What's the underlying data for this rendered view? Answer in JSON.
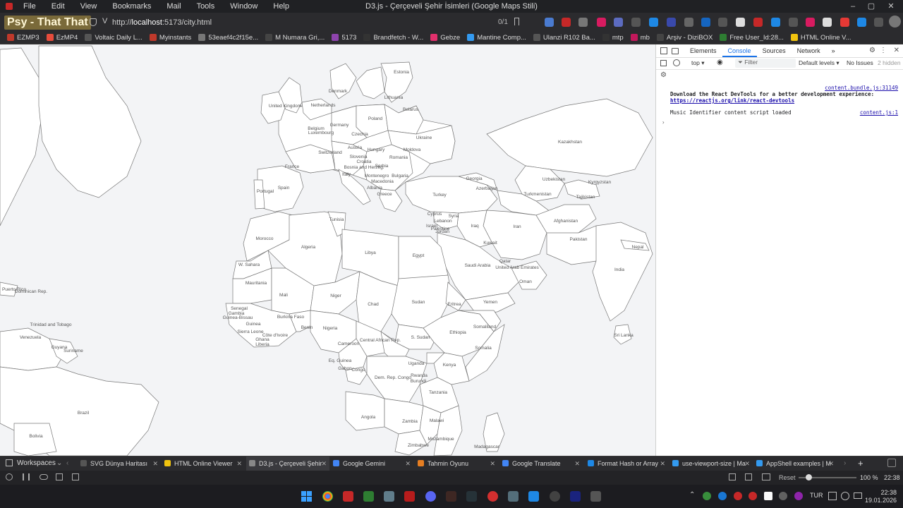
{
  "menubar": {
    "items": [
      "File",
      "Edit",
      "View",
      "Bookmarks",
      "Mail",
      "Tools",
      "Window",
      "Help"
    ]
  },
  "window": {
    "title": "D3.js - Çerçeveli Şehir İsimleri (Google Maps Stili)",
    "minimize": "–",
    "maximize": "▢",
    "close": "✕"
  },
  "lyric": "Psy - That That",
  "address": {
    "scheme": "http://",
    "host": "localhost",
    "path": ":5173/city.html",
    "find_count": "0/1"
  },
  "bookmarks": [
    {
      "label": "EZMP3",
      "color": "#c0392b"
    },
    {
      "label": "EzMP4",
      "color": "#e74c3c"
    },
    {
      "label": "Voltaic Daily L...",
      "color": "#555"
    },
    {
      "label": "Myinstants",
      "color": "#c0392b"
    },
    {
      "label": "53eaef4c2f15e...",
      "color": "#777"
    },
    {
      "label": "M Numara Gri,...",
      "color": "#444"
    },
    {
      "label": "5173",
      "color": "#8e44ad"
    },
    {
      "label": "Brandfetch - W...",
      "color": "#333"
    },
    {
      "label": "Gebze",
      "color": "#e1306c"
    },
    {
      "label": "Mantine Comp...",
      "color": "#339af0"
    },
    {
      "label": "Ulanzi R102 Ba...",
      "color": "#555"
    },
    {
      "label": "mtp",
      "color": "#333"
    },
    {
      "label": "mb",
      "color": "#c2185b"
    },
    {
      "label": "Arşiv - DiziBOX",
      "color": "#444"
    },
    {
      "label": "Free User_Id:28...",
      "color": "#2e7d32"
    },
    {
      "label": "HTML Online V...",
      "color": "#f1c40f"
    }
  ],
  "map": {
    "labels": [
      "Estonia",
      "Denmark",
      "Lithuania",
      "United Kingdom",
      "Netherlands",
      "Belarus",
      "Poland",
      "Germany",
      "Belgium",
      "Luxembourg",
      "Czechia",
      "Ukraine",
      "Austria",
      "Hungary",
      "Moldova",
      "Switzerland",
      "Slovenia",
      "Croatia",
      "Romania",
      "France",
      "Bosnia and Herzeg.",
      "Serbia",
      "Bulgaria",
      "Montenegro",
      "Macedonia",
      "Italy",
      "Albania",
      "Greece",
      "Georgia",
      "Azerbaijan",
      "Kazakhstan",
      "Uzbekistan",
      "Kyrgyzstan",
      "Turkmenistan",
      "Tajikistan",
      "Spain",
      "Portugal",
      "Turkey",
      "Cyprus",
      "Syria",
      "Lebanon",
      "Israel",
      "Palestine",
      "Jordan",
      "Iraq",
      "Iran",
      "Afghanistan",
      "Kuwait",
      "Pakistan",
      "Nepal",
      "Tunisia",
      "Morocco",
      "Algeria",
      "Libya",
      "Egypt",
      "Saudi Arabia",
      "Qatar",
      "United Arab Emirates",
      "India",
      "W. Sahara",
      "Oman",
      "Mauritania",
      "Mali",
      "Niger",
      "Chad",
      "Sudan",
      "Eritrea",
      "Yemen",
      "Senegal",
      "Gambia",
      "Guinea-Bissau",
      "Guinea",
      "Burkina Faso",
      "Sierra Leone",
      "Côte d'Ivoire",
      "Ghana",
      "Benin",
      "Nigeria",
      "Ethiopia",
      "Somaliland",
      "Sri Lanka",
      "Liberia",
      "Central African Rep.",
      "S. Sudan",
      "Cameroon",
      "Somalia",
      "Eq. Guinea",
      "Gabon",
      "Congo",
      "Uganda",
      "Kenya",
      "Rwanda",
      "Burundi",
      "Dem. Rep. Congo",
      "Tanzania",
      "Angola",
      "Zambia",
      "Malawi",
      "Zimbabwe",
      "Mozambique",
      "Madagascar",
      "Trinidad and Tobago",
      "Venezuela",
      "Guyana",
      "Suriname",
      "Brazil",
      "Bolivia",
      "Puerto Rico",
      "Dominican Rep."
    ]
  },
  "devtools": {
    "tabs": [
      "Elements",
      "Console",
      "Sources",
      "Network"
    ],
    "active_tab": "Console",
    "more": "»",
    "context": "top",
    "filter_placeholder": "Filter",
    "levels": "Default levels",
    "issues": "No Issues",
    "hidden": "2 hidden",
    "messages": [
      {
        "source": "content.bundle.js:31149",
        "text": "Download the React DevTools for a better development experience:",
        "link": "https://reactjs.org/link/react-devtools"
      },
      {
        "source": "content.js:1",
        "text": "Music Identifier content script loaded"
      }
    ],
    "prompt": "›"
  },
  "tabs": {
    "workspaces": "Workspaces",
    "items": [
      {
        "label": "SVG Dünya Haritası",
        "color": "#555"
      },
      {
        "label": "HTML Online Viewer",
        "color": "#f1c40f"
      },
      {
        "label": "D3.js - Çerçeveli Şehir",
        "color": "#888"
      },
      {
        "label": "Google Gemini",
        "color": "#4285f4"
      },
      {
        "label": "Tahmin Oyunu",
        "color": "#e67e22"
      },
      {
        "label": "Google Translate",
        "color": "#4285f4"
      },
      {
        "label": "Format Hash or Array",
        "color": "#1e88e5"
      },
      {
        "label": "use-viewport-size | Ma",
        "color": "#339af0"
      },
      {
        "label": "AppShell examples | M",
        "color": "#339af0"
      }
    ],
    "new_tab": "+"
  },
  "status": {
    "reset": "Reset",
    "zoom": "100 %",
    "time": "22:38"
  },
  "taskbar": {
    "lang": "TUR",
    "clock_time": "22:38",
    "clock_date": "19.01.2026"
  },
  "colors": {
    "accent": "#1a73e8",
    "bg": "#1e1e1e",
    "map_bg": "#f3f4f6"
  }
}
